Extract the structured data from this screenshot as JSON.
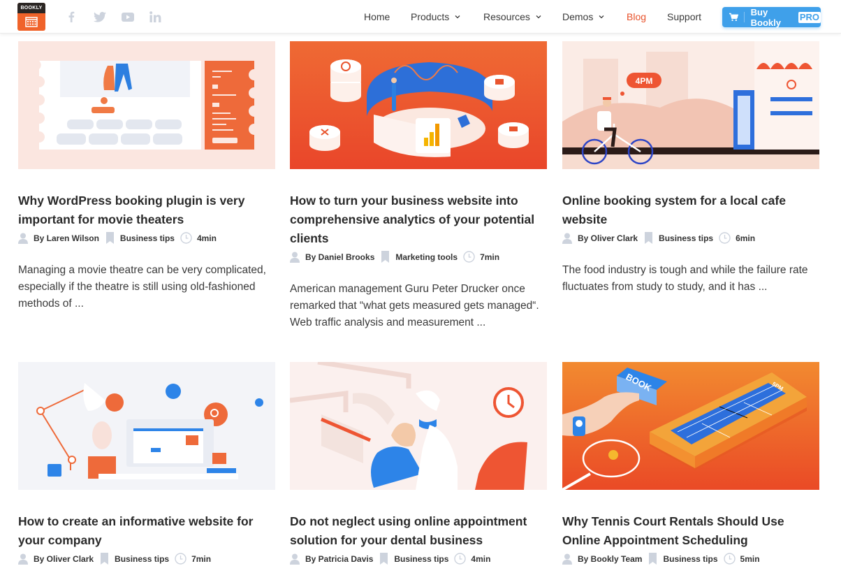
{
  "header": {
    "logo_text": "BOOKLY",
    "social": [
      {
        "name": "facebook-icon",
        "glyph": "f"
      },
      {
        "name": "twitter-icon",
        "glyph": "twitter"
      },
      {
        "name": "youtube-icon",
        "glyph": "youtube"
      },
      {
        "name": "linkedin-icon",
        "glyph": "in"
      }
    ],
    "nav": [
      {
        "label": "Home",
        "dropdown": false,
        "active": false
      },
      {
        "label": "Products",
        "dropdown": true,
        "active": false
      },
      {
        "label": "Resources",
        "dropdown": true,
        "active": false
      },
      {
        "label": "Demos",
        "dropdown": true,
        "active": false
      },
      {
        "label": "Blog",
        "dropdown": false,
        "active": true
      },
      {
        "label": "Support",
        "dropdown": false,
        "active": false
      }
    ],
    "buy_button": {
      "label": "Buy Bookly",
      "badge": "PRO",
      "icon": "cart-icon"
    }
  },
  "colors": {
    "accent": "#e8512a",
    "button": "#3fa0ea",
    "meta_icon": "#cdd3dd",
    "logo_orange": "#f0632a",
    "logo_dark": "#2b2624"
  },
  "posts": [
    {
      "title": "Why WordPress booking plugin is very important for movie theaters",
      "author": "By Laren Wilson",
      "category": "Business tips",
      "read_time": "4min",
      "excerpt": "Managing a movie theatre can be very complicated, especially if the theatre is still using old-fashioned methods of ...",
      "image": "movie-ticket-illustration"
    },
    {
      "title": "How to turn your business website into comprehensive analytics of your potential clients",
      "author": "By Daniel Brooks",
      "category": "Marketing tools",
      "read_time": "7min",
      "excerpt": "American management Guru Peter Drucker once remarked that “what gets measured gets managed“. Web traffic analysis and measurement ...",
      "image": "analytics-dashboard-illustration"
    },
    {
      "title": "Online booking system for a local cafe website",
      "author": "By Oliver Clark",
      "category": "Business tips",
      "read_time": "6min",
      "excerpt": "The food industry is tough and while the failure rate fluctuates from study to study, and it has ...",
      "image": "cafe-cyclist-illustration",
      "image_text": "4PM"
    },
    {
      "title": "How to create an informative website for your company",
      "author": "By Oliver Clark",
      "category": "Business tips",
      "read_time": "7min",
      "excerpt": "",
      "image": "desk-laptop-illustration"
    },
    {
      "title": "Do not neglect using online appointment solution for your dental business",
      "author": "By Patricia Davis",
      "category": "Business tips",
      "read_time": "4min",
      "excerpt": "",
      "image": "dentist-illustration"
    },
    {
      "title": "Why Tennis Court Rentals Should Use Online Appointment Scheduling",
      "author": "By Bookly Team",
      "category": "Business tips",
      "read_time": "5min",
      "excerpt": "",
      "image": "tennis-court-illustration",
      "image_text": "BOOK",
      "image_text_2": "5PM"
    }
  ]
}
